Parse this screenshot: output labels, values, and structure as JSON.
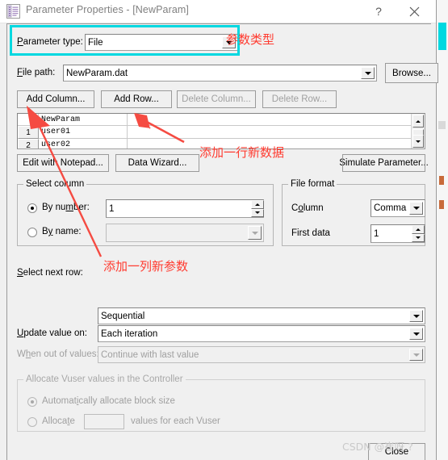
{
  "window": {
    "title": "Parameter Properties - [NewParam]",
    "icon": "parameter-document-icon",
    "help_label": "?",
    "close_label": "✕"
  },
  "parameter_type": {
    "label": "Parameter type:",
    "value": "File",
    "highlight_color": "#00d8e0"
  },
  "file_path": {
    "label": "File path:",
    "value": "NewParam.dat",
    "browse_label": "Browse..."
  },
  "row_buttons": {
    "add_column": "Add Column...",
    "add_row": "Add Row...",
    "delete_column": "Delete Column...",
    "delete_row": "Delete Row..."
  },
  "grid": {
    "column_header": "NewParam",
    "rows": [
      {
        "number": "1",
        "value": "user01"
      },
      {
        "number": "2",
        "value": "user02"
      }
    ]
  },
  "tool_buttons": {
    "edit_with_notepad": "Edit with Notepad...",
    "data_wizard": "Data Wizard...",
    "simulate_parameter": "Simulate Parameter..."
  },
  "select_column": {
    "title": "Select column",
    "by_number_label": "By number:",
    "by_number_value": "1",
    "by_number_selected": true,
    "by_name_label": "By name:",
    "by_name_value": "",
    "by_name_selected": false
  },
  "file_format": {
    "title": "File format",
    "column_label": "Column",
    "column_value": "Comma",
    "first_data_label": "First data",
    "first_data_value": "1"
  },
  "select_next_row": {
    "label": "Select next row:",
    "value": "Sequential"
  },
  "update_value_on": {
    "label": "Update value on:",
    "value": "Each iteration"
  },
  "when_out_of_values": {
    "label": "When out of values:",
    "value": "Continue with last value",
    "disabled": true
  },
  "allocate_group": {
    "title": "Allocate Vuser values in the Controller",
    "auto_label": "Automatically allocate block size",
    "auto_selected": true,
    "allocate_label": "Allocate",
    "allocate_value": "",
    "allocate_suffix": "values for each Vuser",
    "disabled": true
  },
  "footer": {
    "close_label": "Close"
  },
  "annotations": [
    {
      "text": "参数类型",
      "color": "#ff3b30"
    },
    {
      "text": "添加一行新数据",
      "color": "#ff3b30"
    },
    {
      "text": "添加一列新参数",
      "color": "#ff3b30"
    }
  ],
  "watermark": {
    "text": "CSDN @崔呀 ?"
  }
}
